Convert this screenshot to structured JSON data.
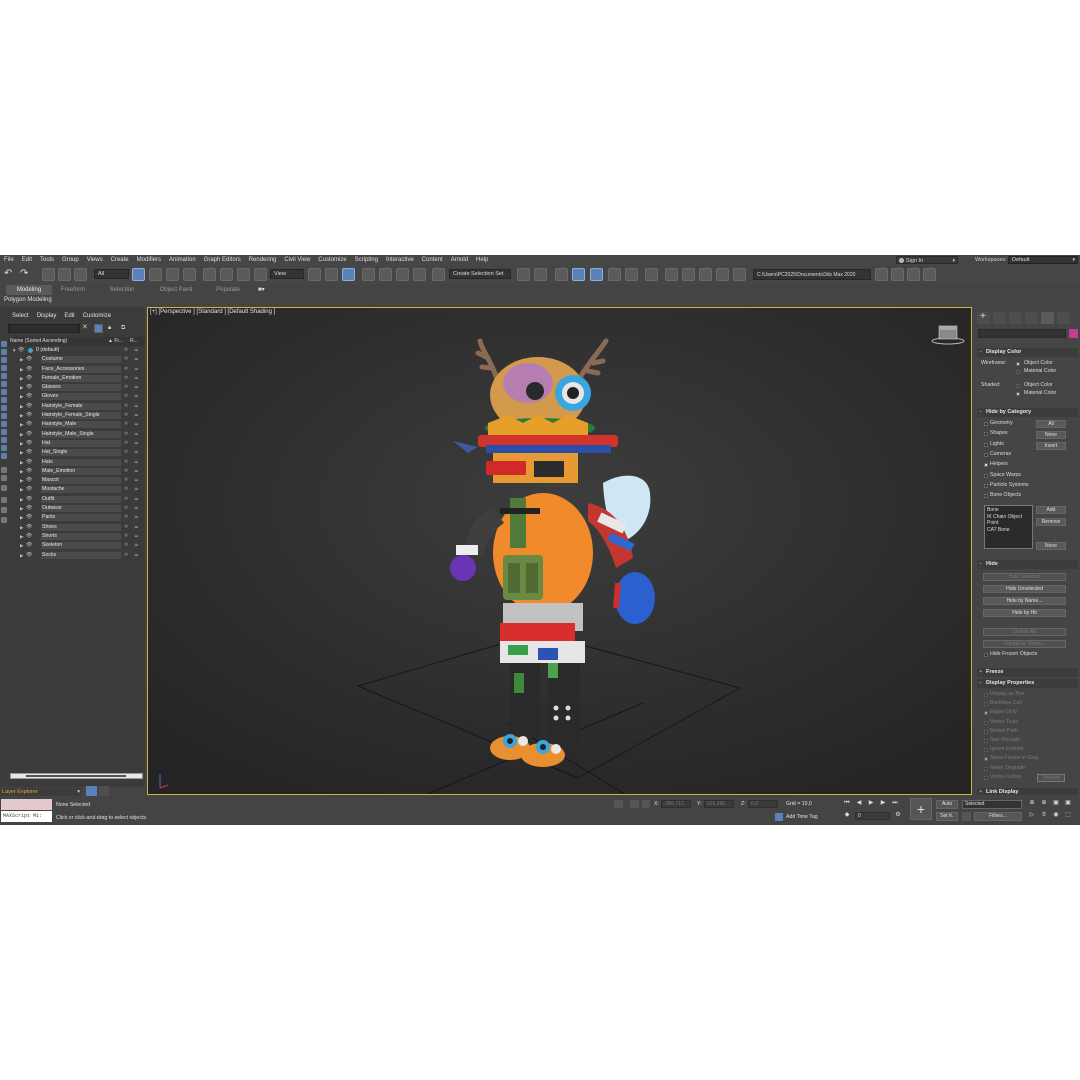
{
  "menubar": {
    "items": [
      "File",
      "Edit",
      "Tools",
      "Group",
      "Views",
      "Create",
      "Modifiers",
      "Animation",
      "Graph Editors",
      "Rendering",
      "Civil View",
      "Customize",
      "Scripting",
      "Interactive",
      "Content",
      "Arnold",
      "Help"
    ],
    "sign_in": "Sign In",
    "workspaces_label": "Workspaces:",
    "workspaces_value": "Default"
  },
  "toolbar": {
    "filter_value": "All",
    "coord_system": "View",
    "selection_set": "Create Selection Set",
    "project_path": "C:\\Users\\PC2025\\Documents\\3ds Max 2020"
  },
  "ribbon": {
    "tabs": [
      "Modeling",
      "Freeform",
      "Selection",
      "Object Paint",
      "Populate"
    ],
    "active_tab": "Modeling",
    "sub_label": "Polygon Modeling"
  },
  "explorer": {
    "menu": [
      "Select",
      "Display",
      "Edit",
      "Customize"
    ],
    "header_name": "Name (Sorted Ascending)",
    "header_col1": "▲ Fr...",
    "header_col2": "R...",
    "root": "0 (default)",
    "layers": [
      "Costume",
      "Face_Accessories",
      "Female_Emotion",
      "Glasses",
      "Gloves",
      "Hairstyle_Female",
      "Hairstyle_Female_Single",
      "Hairstyle_Male",
      "Hairstyle_Male_Single",
      "Hat",
      "Hat_Single",
      "Hats",
      "Male_Emotion",
      "Mascot",
      "Mustache",
      "Outfit",
      "Outwear",
      "Pants",
      "Shoes",
      "Shorts",
      "Skeleton",
      "Socks"
    ],
    "footer_label": "Layer Explorer"
  },
  "viewport": {
    "label": "[+] [Perspective ] [Standard ] [Default Shading ]"
  },
  "cmdpanel": {
    "display_color": {
      "title": "Display Color",
      "wireframe_label": "Wireframe:",
      "shaded_label": "Shaded:",
      "opt_object": "Object Color",
      "opt_material": "Material Color"
    },
    "hide_by_category": {
      "title": "Hide by Category",
      "items": [
        "Geometry",
        "Shapes",
        "Lights",
        "Cameras",
        "Helpers",
        "Space Warps",
        "Particle Systems",
        "Bone Objects"
      ],
      "btn_all": "All",
      "btn_none": "None",
      "btn_invert": "Invert",
      "list": [
        "Bone",
        "IK Chain Object",
        "Point",
        "CAT Bone"
      ],
      "btn_add": "Add",
      "btn_remove": "Remove",
      "btn_none2": "None"
    },
    "hide": {
      "title": "Hide",
      "buttons": [
        "Hide Selected",
        "Hide Unselected",
        "Hide by Name...",
        "Hide by Hit",
        "Unhide All",
        "Unhide by Name..."
      ],
      "checkbox": "Hide Frozen Objects"
    },
    "freeze": {
      "title": "Freeze"
    },
    "display_properties": {
      "title": "Display Properties",
      "items": [
        "Display as Box",
        "Backface Cull",
        "Edges Only",
        "Vertex Ticks",
        "Motion Path",
        "See-Through",
        "Ignore Extents",
        "Show Frozen in Gray",
        "Never Degrade",
        "Vertex Colors"
      ],
      "shaded_btn": "Shaded"
    },
    "link_display": {
      "title": "Link Display"
    }
  },
  "status": {
    "selection": "None Selected",
    "prompt": "Click or click-and-drag to select objects",
    "maxscript": "MAXScript Mi:",
    "x_label": "X:",
    "x_value": "-366,712",
    "y_label": "Y:",
    "y_value": "919,298",
    "z_label": "Z:",
    "z_value": "0,0",
    "grid": "Grid = 10,0",
    "add_time_tag": "Add Time Tag",
    "auto": "Auto",
    "set_key": "Set K.",
    "selected": "Selected",
    "filters": "Filters...",
    "frame": "0"
  }
}
